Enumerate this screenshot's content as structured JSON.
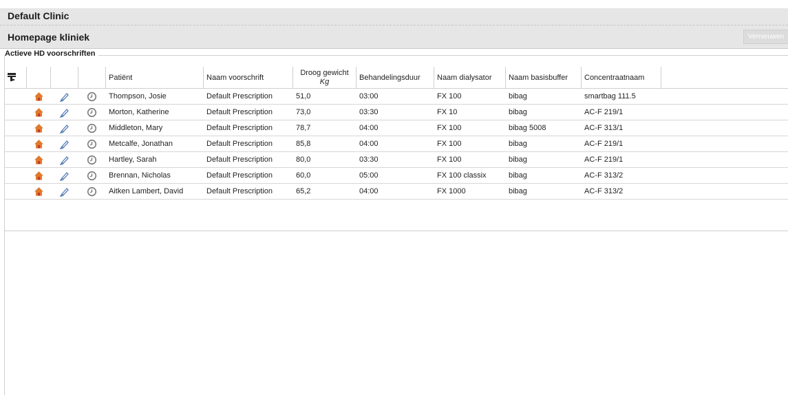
{
  "header": {
    "clinic": "Default Clinic"
  },
  "page": {
    "title": "Homepage kliniek",
    "refresh_label": "Vernieuwen"
  },
  "section": {
    "title": "Actieve HD voorschriften"
  },
  "colors": {
    "home_icon": "#e07a2c",
    "home_door": "#c0392b",
    "pen_icon": "#5b7fb8",
    "clock_icon": "#7a7a7a"
  },
  "table": {
    "columns": {
      "patient": "Patiënt",
      "prescription": "Naam voorschrift",
      "dry_weight": "Droog gewicht",
      "dry_weight_unit": "Kg",
      "duration": "Behandelingsduur",
      "dialyzer": "Naam dialysator",
      "buffer": "Naam basisbuffer",
      "concentrate": "Concentraatnaam"
    },
    "rows": [
      {
        "patient": "Thompson, Josie",
        "prescription": "Default Prescription",
        "dry_weight": "51,0",
        "duration": "03:00",
        "dialyzer": "FX 100",
        "buffer": "bibag",
        "concentrate": "smartbag 111.5"
      },
      {
        "patient": "Morton, Katherine",
        "prescription": "Default Prescription",
        "dry_weight": "73,0",
        "duration": "03:30",
        "dialyzer": "FX 10",
        "buffer": "bibag",
        "concentrate": "AC-F 219/1"
      },
      {
        "patient": "Middleton, Mary",
        "prescription": "Default Prescription",
        "dry_weight": "78,7",
        "duration": "04:00",
        "dialyzer": "FX 100",
        "buffer": "bibag 5008",
        "concentrate": "AC-F 313/1"
      },
      {
        "patient": "Metcalfe, Jonathan",
        "prescription": "Default Prescription",
        "dry_weight": "85,8",
        "duration": "04:00",
        "dialyzer": "FX 100",
        "buffer": "bibag",
        "concentrate": "AC-F 219/1"
      },
      {
        "patient": "Hartley, Sarah",
        "prescription": "Default Prescription",
        "dry_weight": "80,0",
        "duration": "03:30",
        "dialyzer": "FX 100",
        "buffer": "bibag",
        "concentrate": "AC-F 219/1"
      },
      {
        "patient": "Brennan, Nicholas",
        "prescription": "Default Prescription",
        "dry_weight": "60,0",
        "duration": "05:00",
        "dialyzer": "FX 100 classix",
        "buffer": "bibag",
        "concentrate": "AC-F 313/2"
      },
      {
        "patient": "Aitken Lambert, David",
        "prescription": "Default Prescription",
        "dry_weight": "65,2",
        "duration": "04:00",
        "dialyzer": "FX 1000",
        "buffer": "bibag",
        "concentrate": "AC-F 313/2"
      }
    ]
  }
}
